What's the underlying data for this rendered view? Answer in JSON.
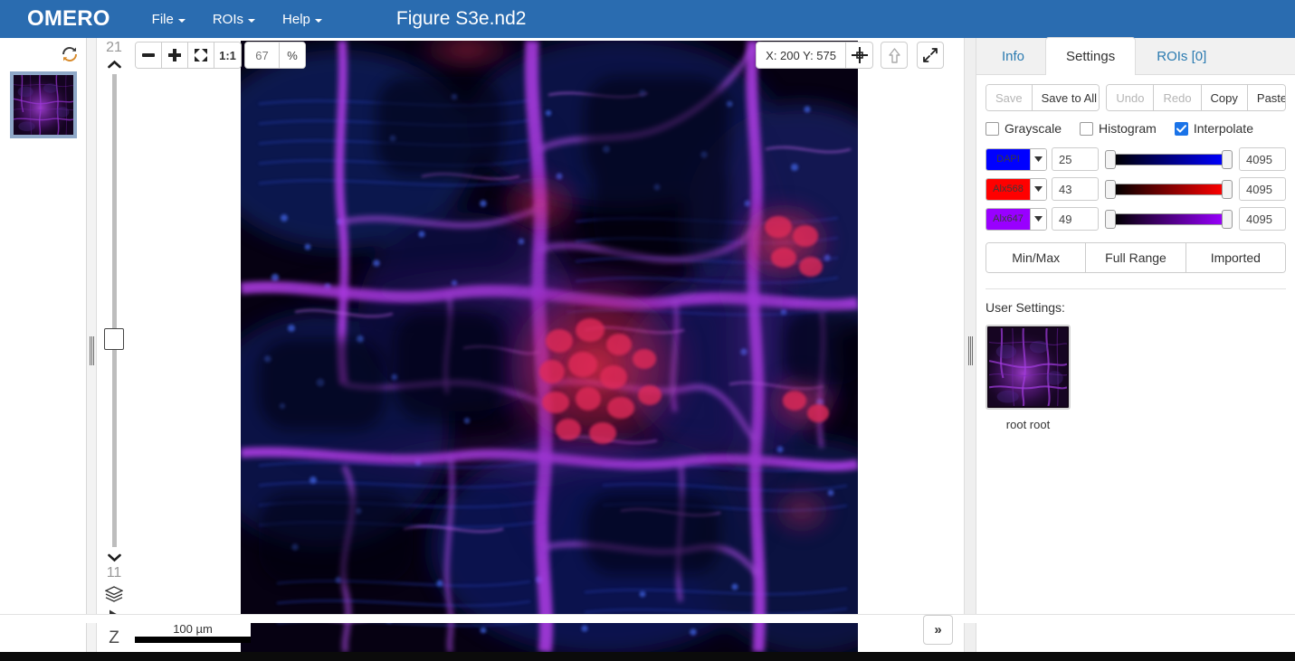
{
  "topbar": {
    "brand": "OMERO",
    "menus": [
      {
        "label": "File",
        "name": "menu-file"
      },
      {
        "label": "ROIs",
        "name": "menu-rois"
      },
      {
        "label": "Help",
        "name": "menu-help"
      }
    ],
    "document_title": "Figure S3e.nd2",
    "background_color": "#2a6cb0"
  },
  "thumbnails": {
    "refresh_icon": "refresh-icon",
    "selected_index": 0,
    "items": [
      {
        "name": "thumbnail-figure-s3e",
        "selected": true
      }
    ]
  },
  "zcontrol": {
    "max_label": "21",
    "current_label": "11",
    "up_icon": "chevron-up-icon",
    "down_icon": "chevron-down-icon",
    "projection_icon": "layers-icon",
    "play_icon": "play-icon",
    "axis_label": "Z"
  },
  "viewport": {
    "zoom": {
      "minus_label": "–",
      "plus_label": "+",
      "fit_icon": "fit-to-screen-icon",
      "one_to_one_label": "1:1",
      "value": "67",
      "unit": "%"
    },
    "coordinates": "X: 200 Y: 575",
    "crosshair_icon": "crosshair-icon",
    "up_icon": "arrow-up-icon",
    "fullscreen_icon": "expand-diagonal-icon",
    "scalebar_label": "100 µm",
    "panel_toggle_label": "»"
  },
  "rightpanel": {
    "tabs": [
      {
        "label": "Info",
        "name": "tab-info",
        "active": false
      },
      {
        "label": "Settings",
        "name": "tab-settings",
        "active": true
      },
      {
        "label": "ROIs [0]",
        "name": "tab-rois",
        "active": false
      }
    ],
    "actions": [
      {
        "label": "Save",
        "name": "save-button",
        "disabled": true
      },
      {
        "label": "Save to All",
        "name": "save-to-all-button",
        "disabled": false
      },
      {
        "label": "Undo",
        "name": "undo-button",
        "disabled": true
      },
      {
        "label": "Redo",
        "name": "redo-button",
        "disabled": true
      },
      {
        "label": "Copy",
        "name": "copy-button",
        "disabled": false
      },
      {
        "label": "Paste",
        "name": "paste-button",
        "disabled": false
      }
    ],
    "checkboxes": [
      {
        "label": "Grayscale",
        "name": "grayscale-checkbox",
        "checked": false
      },
      {
        "label": "Histogram",
        "name": "histogram-checkbox",
        "checked": false
      },
      {
        "label": "Interpolate",
        "name": "interpolate-checkbox",
        "checked": true
      }
    ],
    "channels": [
      {
        "label": "DAPI",
        "color": "#0000FF",
        "min": "25",
        "max": "4095"
      },
      {
        "label": "Alx568",
        "color": "#FF0000",
        "min": "43",
        "max": "4095"
      },
      {
        "label": "Alx647",
        "color": "#9900FF",
        "min": "49",
        "max": "4095"
      }
    ],
    "range_buttons": [
      {
        "label": "Min/Max",
        "name": "min-max-button"
      },
      {
        "label": "Full Range",
        "name": "full-range-button"
      },
      {
        "label": "Imported",
        "name": "imported-button"
      }
    ],
    "user_settings": {
      "title": "User Settings:",
      "entries": [
        {
          "name": "root root"
        }
      ]
    },
    "accent_color": "#1a73e8",
    "link_color": "#2a7ab0"
  }
}
